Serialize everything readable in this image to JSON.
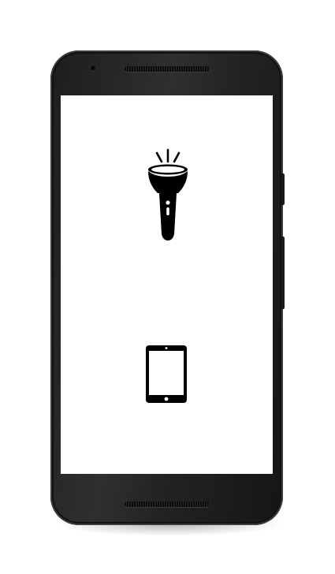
{
  "device": {
    "model": "android-phone",
    "frame_color": "#222222",
    "screen_color": "#ffffff"
  },
  "screen": {
    "buttons": [
      {
        "icon": "flashlight-icon",
        "color": "#000000"
      },
      {
        "icon": "tablet-icon",
        "color": "#000000"
      }
    ]
  }
}
